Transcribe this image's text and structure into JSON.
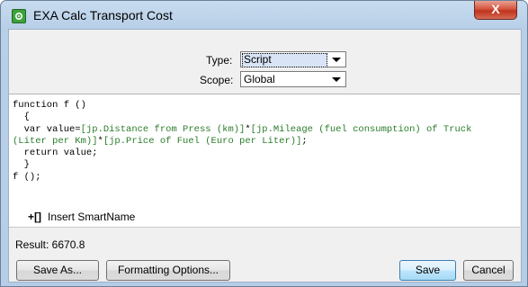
{
  "window": {
    "title": "EXA Calc Transport Cost",
    "close_label": "X"
  },
  "form": {
    "type_label": "Type:",
    "type_value": "Script",
    "scope_label": "Scope:",
    "scope_value": "Global"
  },
  "editor": {
    "lines": [
      [
        {
          "t": "function f ()"
        }
      ],
      [
        {
          "t": "  {"
        }
      ],
      [
        {
          "t": "  var value="
        },
        {
          "t": "[jp.Distance from Press (km)]",
          "g": true
        },
        {
          "t": "*"
        },
        {
          "t": "[jp.Mileage (fuel consumption) of Truck",
          "g": true
        }
      ],
      [
        {
          "t": "(Liter per Km)]",
          "g": true
        },
        {
          "t": "*"
        },
        {
          "t": "[jp.Price of Fuel (Euro per Liter)]",
          "g": true
        },
        {
          "t": ";"
        }
      ],
      [
        {
          "t": "  return value;"
        }
      ],
      [
        {
          "t": "  }"
        }
      ],
      [
        {
          "t": "f ();"
        }
      ]
    ]
  },
  "smartname": {
    "icon": "+[]",
    "label": "Insert SmartName"
  },
  "result": {
    "text": "Result: 6670.8"
  },
  "buttons": {
    "save_as": "Save As...",
    "formatting": "Formatting Options...",
    "save": "Save",
    "cancel": "Cancel"
  }
}
